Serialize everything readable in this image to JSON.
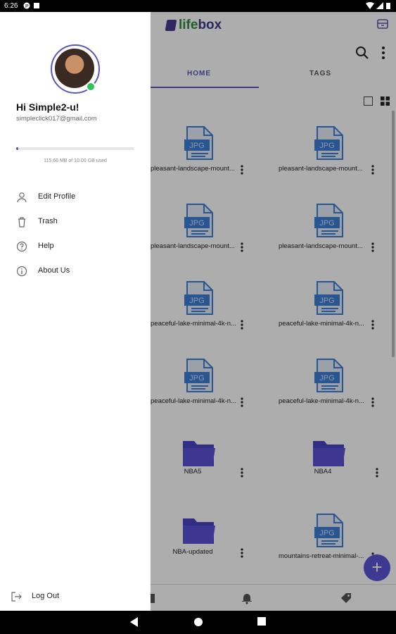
{
  "status_bar": {
    "time": "6:26"
  },
  "app": {
    "logo": {
      "part1": "life",
      "part2": "box"
    },
    "tabs": [
      {
        "label": "HOME",
        "active": true
      },
      {
        "label": "TAGS",
        "active": false
      }
    ],
    "files": [
      {
        "name": "pleasant-landscape-mount...",
        "kind": "jpg",
        "thumb_label": "JPG"
      },
      {
        "name": "pleasant-landscape-mount...",
        "kind": "jpg",
        "thumb_label": "JPG"
      },
      {
        "name": "pleasant-landscape-mount...",
        "kind": "jpg",
        "thumb_label": "JPG"
      },
      {
        "name": "pleasant-landscape-mount...",
        "kind": "jpg",
        "thumb_label": "JPG"
      },
      {
        "name": "peaceful-lake-minimal-4k-n...",
        "kind": "jpg",
        "thumb_label": "JPG"
      },
      {
        "name": "peaceful-lake-minimal-4k-n...",
        "kind": "jpg",
        "thumb_label": "JPG"
      },
      {
        "name": "peaceful-lake-minimal-4k-n...",
        "kind": "jpg",
        "thumb_label": "JPG"
      },
      {
        "name": "peaceful-lake-minimal-4k-n...",
        "kind": "jpg",
        "thumb_label": "JPG"
      },
      {
        "name": "NBA5",
        "kind": "folder"
      },
      {
        "name": "NBA4",
        "kind": "folder"
      },
      {
        "name": "NBA-updated",
        "kind": "folder"
      },
      {
        "name": "mountains-retreat-minimal-...",
        "kind": "jpg",
        "thumb_label": "JPG"
      }
    ],
    "fab_label": "+"
  },
  "drawer": {
    "greeting": "Hi Simple2-u!",
    "email": "simpleclick017@gmail.com",
    "storage": {
      "text": "115.66 MB of 10.00 GB used",
      "used_fraction": 0.012
    },
    "menu": [
      {
        "label": "Edit Profile",
        "icon": "user-icon"
      },
      {
        "label": "Trash",
        "icon": "trash-icon"
      },
      {
        "label": "Help",
        "icon": "help-icon"
      },
      {
        "label": "About Us",
        "icon": "info-icon"
      }
    ],
    "logout_label": "Log Out"
  },
  "colors": {
    "brand_purple": "#5c56b8",
    "brand_green": "#2f8a3e",
    "fab": "#5b55d6",
    "jpg_blue": "#3d7fd6",
    "folder_purple": "#5a52d6",
    "online": "#2fc45b"
  }
}
